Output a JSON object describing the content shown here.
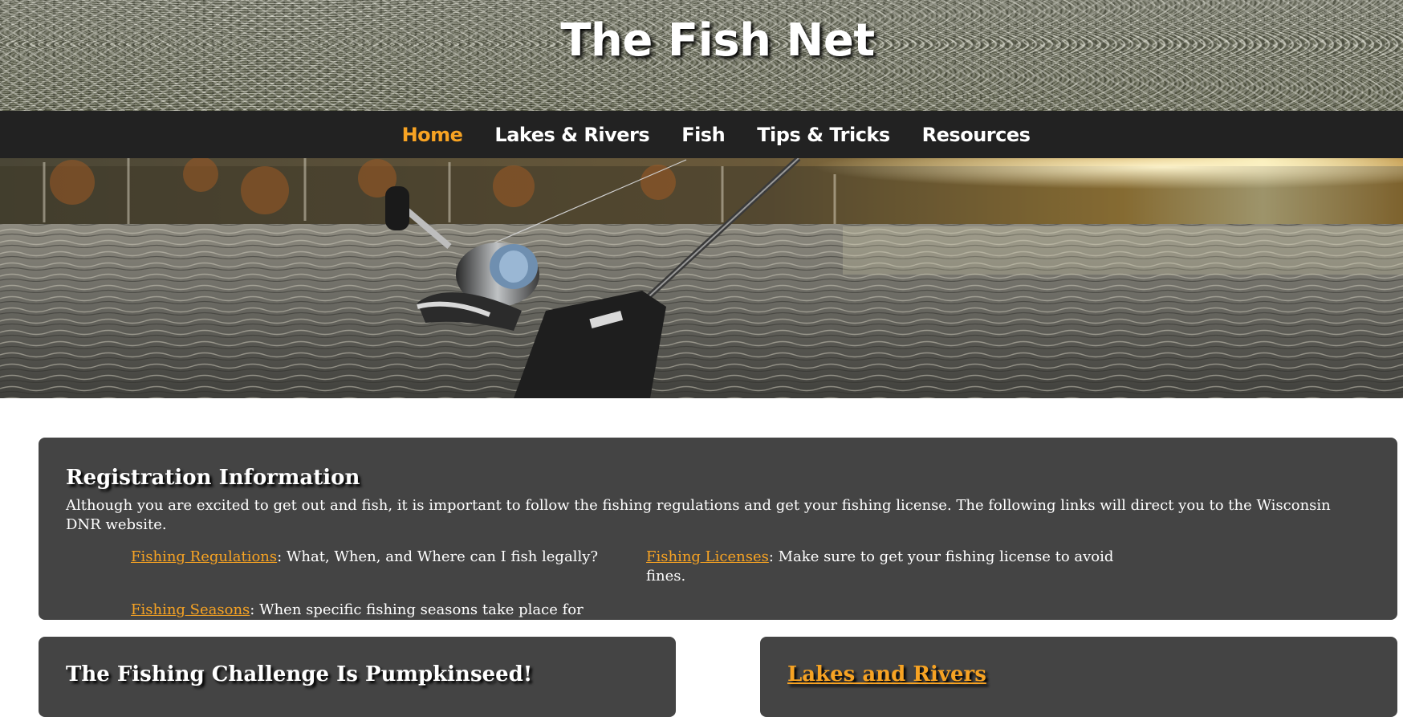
{
  "site": {
    "title": "The Fish Net"
  },
  "nav": {
    "items": [
      {
        "label": "Home",
        "active": true
      },
      {
        "label": "Lakes & Rivers",
        "active": false
      },
      {
        "label": "Fish",
        "active": false
      },
      {
        "label": "Tips & Tricks",
        "active": false
      },
      {
        "label": "Resources",
        "active": false
      }
    ],
    "active_color": "#f7a323",
    "background_color": "#222222"
  },
  "registration": {
    "title": "Registration Information",
    "intro": "Although you are excited to get out and fish, it is important to follow the fishing regulations and get your fishing license. The following links will direct you to the Wisconsin DNR website.",
    "links": [
      {
        "link_text": "Fishing Regulations",
        "description": ": What, When, and Where can I fish legally?"
      },
      {
        "link_text": "Fishing Licenses",
        "description": ": Make sure to get your fishing license to avoid fines."
      },
      {
        "link_text": "Fishing Seasons",
        "description": ": When specific fishing seasons take place for Wisconsin."
      }
    ]
  },
  "challenge": {
    "title": "The Fishing Challenge Is Pumpkinseed!"
  },
  "lakes": {
    "title": "Lakes and Rivers"
  },
  "colors": {
    "link": "#f7a323",
    "panel": "#444444"
  }
}
